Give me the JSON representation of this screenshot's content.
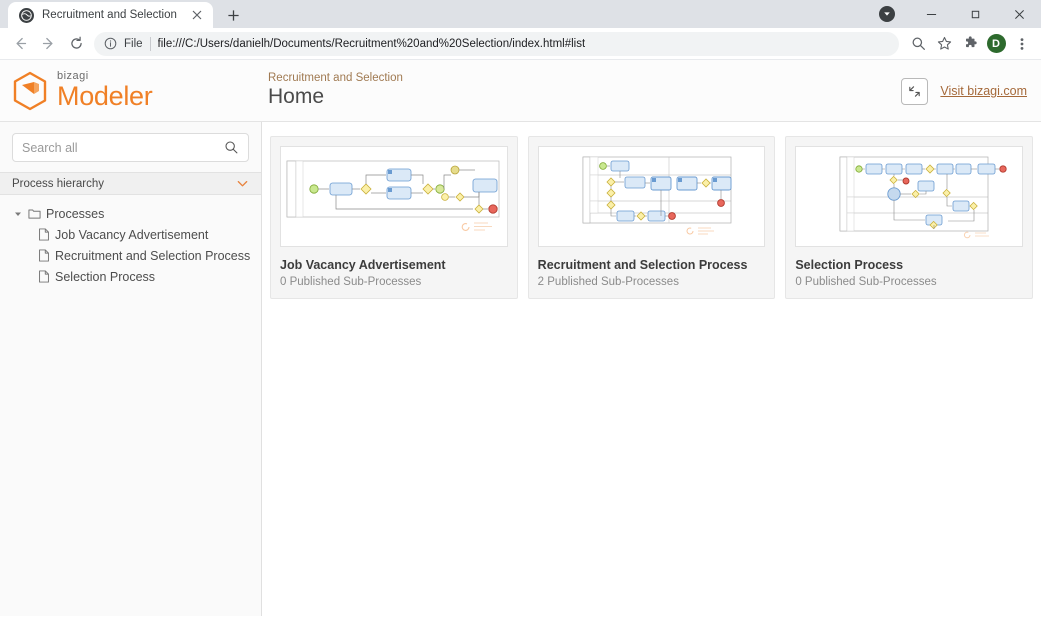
{
  "browser": {
    "tab": {
      "title": "Recruitment and Selection",
      "favicon": "globe-icon",
      "close": "close-icon"
    },
    "new_tab_label": "+",
    "window_controls": {
      "download": "download-badge-icon",
      "minimize": "minimize-icon",
      "maximize": "maximize-icon",
      "close": "close-window-icon"
    },
    "nav": {
      "back": "back-arrow-icon",
      "forward": "forward-arrow-icon",
      "reload": "reload-icon"
    },
    "omnibox": {
      "info_icon": "info-circle-icon",
      "scheme_label": "File",
      "url": "file:///C:/Users/danielh/Documents/Recruitment%20and%20Selection/index.html#list"
    },
    "toolbar_icons": {
      "search": "search-icon",
      "bookmark": "star-icon",
      "extensions": "puzzle-icon",
      "menu": "three-dot-menu-icon"
    },
    "profile": {
      "initial": "D",
      "color": "#2d6a2d"
    }
  },
  "app_header": {
    "brand_sub": "bizagi",
    "brand_name": "Modeler",
    "breadcrumb": "Recruitment and Selection",
    "title": "Home",
    "expand_icon": "collapse-diagonal-icon",
    "visit_link": "Visit bizagi.com",
    "accent_color": "#f08026"
  },
  "sidebar": {
    "search": {
      "placeholder": "Search all",
      "value": "",
      "icon": "search-icon"
    },
    "section": {
      "label": "Process hierarchy",
      "chevron": "chevron-down-icon"
    },
    "tree": {
      "root": {
        "label": "Processes",
        "icon": "folder-icon",
        "twisty": "triangle-down-icon"
      },
      "items": [
        {
          "label": "Job Vacancy Advertisement",
          "icon": "document-icon"
        },
        {
          "label": "Recruitment and Selection Process",
          "icon": "document-icon"
        },
        {
          "label": "Selection Process",
          "icon": "document-icon"
        }
      ]
    }
  },
  "main": {
    "cards": [
      {
        "title": "Job Vacancy Advertisement",
        "subtitle": "0 Published Sub-Processes",
        "thumbnail": "bpmn-diagram-thumbnail"
      },
      {
        "title": "Recruitment and Selection Process",
        "subtitle": "2 Published Sub-Processes",
        "thumbnail": "bpmn-diagram-thumbnail"
      },
      {
        "title": "Selection Process",
        "subtitle": "0 Published Sub-Processes",
        "thumbnail": "bpmn-diagram-thumbnail"
      }
    ]
  }
}
